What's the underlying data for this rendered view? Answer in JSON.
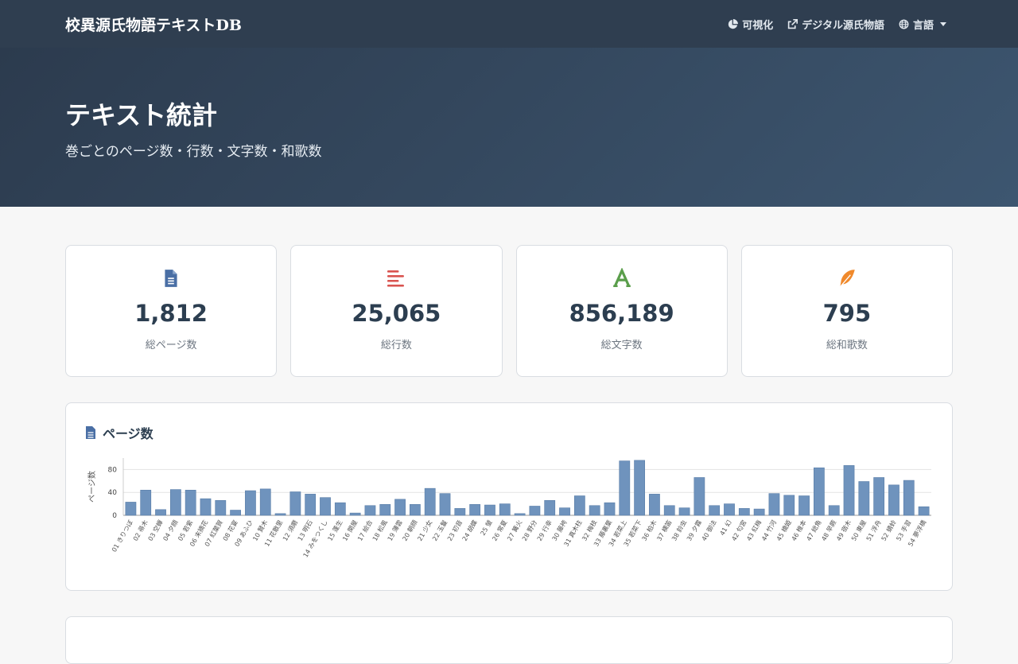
{
  "nav": {
    "brand": "校異源氏物語テキストDB",
    "items": [
      {
        "label": "可視化",
        "icon": "pie-chart-icon"
      },
      {
        "label": "デジタル源氏物語",
        "icon": "external-link-icon"
      },
      {
        "label": "言語",
        "icon": "globe-icon"
      }
    ]
  },
  "hero": {
    "title": "テキスト統計",
    "subtitle": "巻ごとのページ数・行数・文字数・和歌数"
  },
  "stats": [
    {
      "value": "1,812",
      "label": "総ページ数",
      "icon": "file-icon",
      "color": "#4a6fa5"
    },
    {
      "value": "25,065",
      "label": "総行数",
      "icon": "align-left-icon",
      "color": "#d9534f"
    },
    {
      "value": "856,189",
      "label": "総文字数",
      "icon": "font-icon",
      "color": "#5a9e4b"
    },
    {
      "value": "795",
      "label": "総和歌数",
      "icon": "feather-icon",
      "color": "#f0892b"
    }
  ],
  "page_panel": {
    "title": "ページ数"
  },
  "chart_data": {
    "type": "bar",
    "ylabel": "ページ数",
    "xlabel": "",
    "ylim": [
      0,
      100
    ],
    "yticks": [
      0,
      40,
      80
    ],
    "grid": true,
    "bar_color": "#6f93bd",
    "categories": [
      "01 きりつぼ",
      "02 帚木",
      "03 空蟬",
      "04 夕顔",
      "05 若紫",
      "06 末摘花",
      "07 紅葉賀",
      "08 花宴",
      "09 あふひ",
      "10 賢木",
      "11 花散里",
      "12 須磨",
      "13 明石",
      "14 みをつくし",
      "15 蓬生",
      "16 関屋",
      "17 絵合",
      "18 松風",
      "19 薄雲",
      "20 朝顔",
      "21 少女",
      "22 玉鬘",
      "23 初音",
      "24 胡蝶",
      "25 螢",
      "26 常夏",
      "27 篝火",
      "28 野分",
      "29 行幸",
      "30 藤袴",
      "31 真木柱",
      "32 梅枝",
      "33 藤裏葉",
      "34 若菜上",
      "35 若菜下",
      "36 柏木",
      "37 横笛",
      "38 鈴虫",
      "39 夕霧",
      "40 御法",
      "41 幻",
      "42 匂宮",
      "43 紅梅",
      "44 竹河",
      "45 橋姫",
      "46 椎本",
      "47 総角",
      "48 早蕨",
      "49 宿木",
      "50 東屋",
      "51 浮舟",
      "52 蜻蛉",
      "53 手習",
      "54 夢浮橋"
    ],
    "values": [
      23,
      44,
      10,
      45,
      44,
      29,
      26,
      9,
      43,
      46,
      3,
      41,
      37,
      31,
      22,
      4,
      17,
      19,
      28,
      19,
      47,
      38,
      12,
      19,
      18,
      20,
      3,
      16,
      26,
      13,
      34,
      17,
      22,
      95,
      96,
      37,
      17,
      13,
      66,
      17,
      20,
      12,
      11,
      38,
      35,
      34,
      83,
      17,
      87,
      59,
      66,
      53,
      61,
      15
    ]
  }
}
